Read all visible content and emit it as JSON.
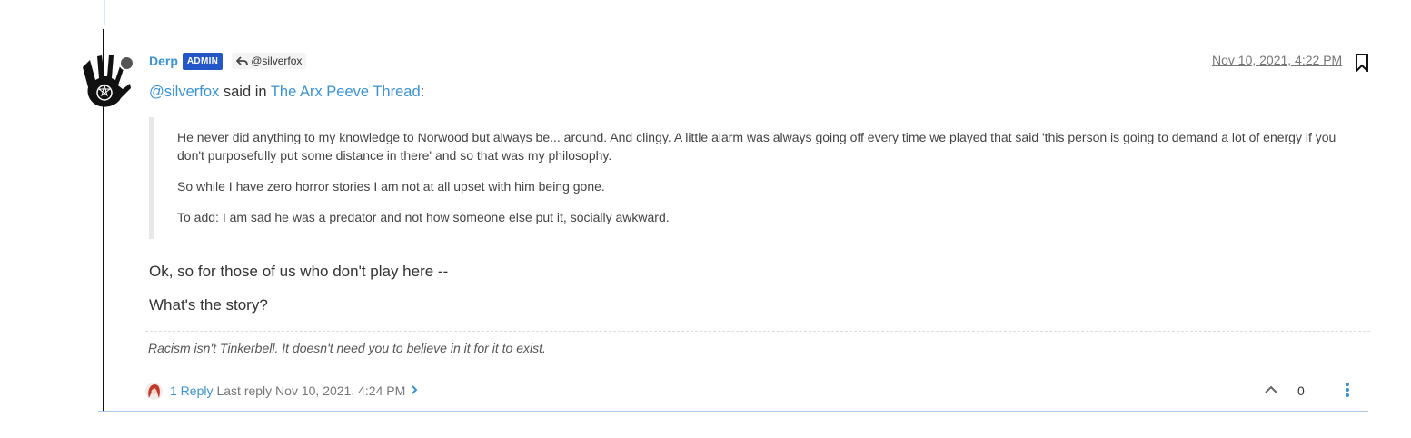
{
  "post": {
    "author": "Derp",
    "badge": "ADMIN",
    "reply_to": "@silverfox",
    "timestamp": "Nov 10, 2021, 4:22 PM",
    "quote_header": {
      "mention": "@silverfox",
      "said_in": " said in ",
      "thread": "The Arx Peeve Thread",
      "colon": ":"
    },
    "quote_paragraphs": [
      "He never did anything to my knowledge to Norwood but always be... around. And clingy. A little alarm was always going off every time we played that said 'this person is going to demand a lot of energy if you don't purposefully put some distance in there' and so that was my philosophy.",
      "So while I have zero horror stories I am not at all upset with him being gone.",
      "To add: I am sad he was a predator and not how someone else put it, socially awkward."
    ],
    "body_paragraphs": [
      "Ok, so for those of us who don't play here --",
      "What's the story?"
    ],
    "signature": "Racism isn't Tinkerbell. It doesn't need you to believe in it for it to exist.",
    "footer": {
      "reply_count": "1 Reply",
      "last_reply": "Last reply Nov 10, 2021, 4:24 PM"
    },
    "votes": "0"
  },
  "colors": {
    "link": "#3a92d4",
    "badge": "#2458c8",
    "thread_line": "#111111"
  },
  "icons": {
    "reply": "reply-arrow-icon",
    "bookmark": "bookmark-icon",
    "upvote": "chevron-up-icon",
    "more": "kebab-menu-icon",
    "expand": "chevron-right-icon"
  }
}
